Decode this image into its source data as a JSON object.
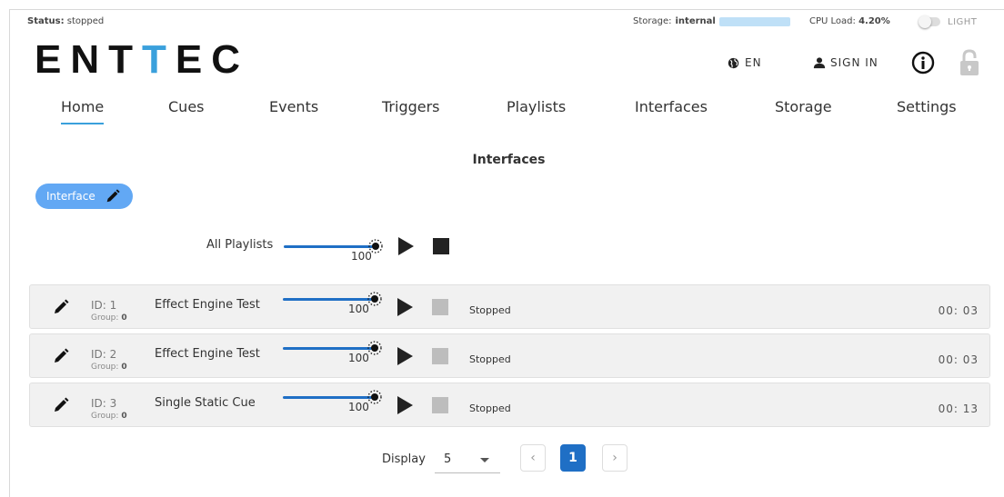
{
  "statusbar": {
    "status_label": "Status:",
    "status_value": "stopped",
    "storage_label": "Storage:",
    "storage_value": "internal",
    "cpu_label": "CPU Load:",
    "cpu_value": "4.20%",
    "theme_label": "LIGHT"
  },
  "header": {
    "logo_part1": "ENT",
    "logo_part2": "T",
    "logo_part3": "EC",
    "language": "EN",
    "signin": "SIGN IN"
  },
  "nav": {
    "items": [
      {
        "label": "Home",
        "active": true
      },
      {
        "label": "Cues"
      },
      {
        "label": "Events"
      },
      {
        "label": "Triggers"
      },
      {
        "label": "Playlists"
      },
      {
        "label": "Interfaces"
      },
      {
        "label": "Storage"
      },
      {
        "label": "Settings"
      }
    ]
  },
  "main": {
    "title": "Interfaces",
    "chip_label": "Interface",
    "all_playlists": {
      "label": "All Playlists",
      "level": "100"
    },
    "rows": [
      {
        "id": "ID: 1",
        "group_label": "Group:",
        "group": "0",
        "name": "Effect Engine Test",
        "level": "100",
        "state": "Stopped",
        "time": "00: 03"
      },
      {
        "id": "ID: 2",
        "group_label": "Group:",
        "group": "0",
        "name": "Effect Engine Test",
        "level": "100",
        "state": "Stopped",
        "time": "00: 03"
      },
      {
        "id": "ID: 3",
        "group_label": "Group:",
        "group": "0",
        "name": "Single Static Cue",
        "level": "100",
        "state": "Stopped",
        "time": "00: 13"
      }
    ]
  },
  "pagination": {
    "display_label": "Display",
    "page_size": "5",
    "prev": "‹",
    "current_page": "1",
    "next": "›"
  },
  "colors": {
    "accent": "#3aa0dc",
    "primary": "#1f6fc5",
    "chip": "#62a8f4"
  }
}
